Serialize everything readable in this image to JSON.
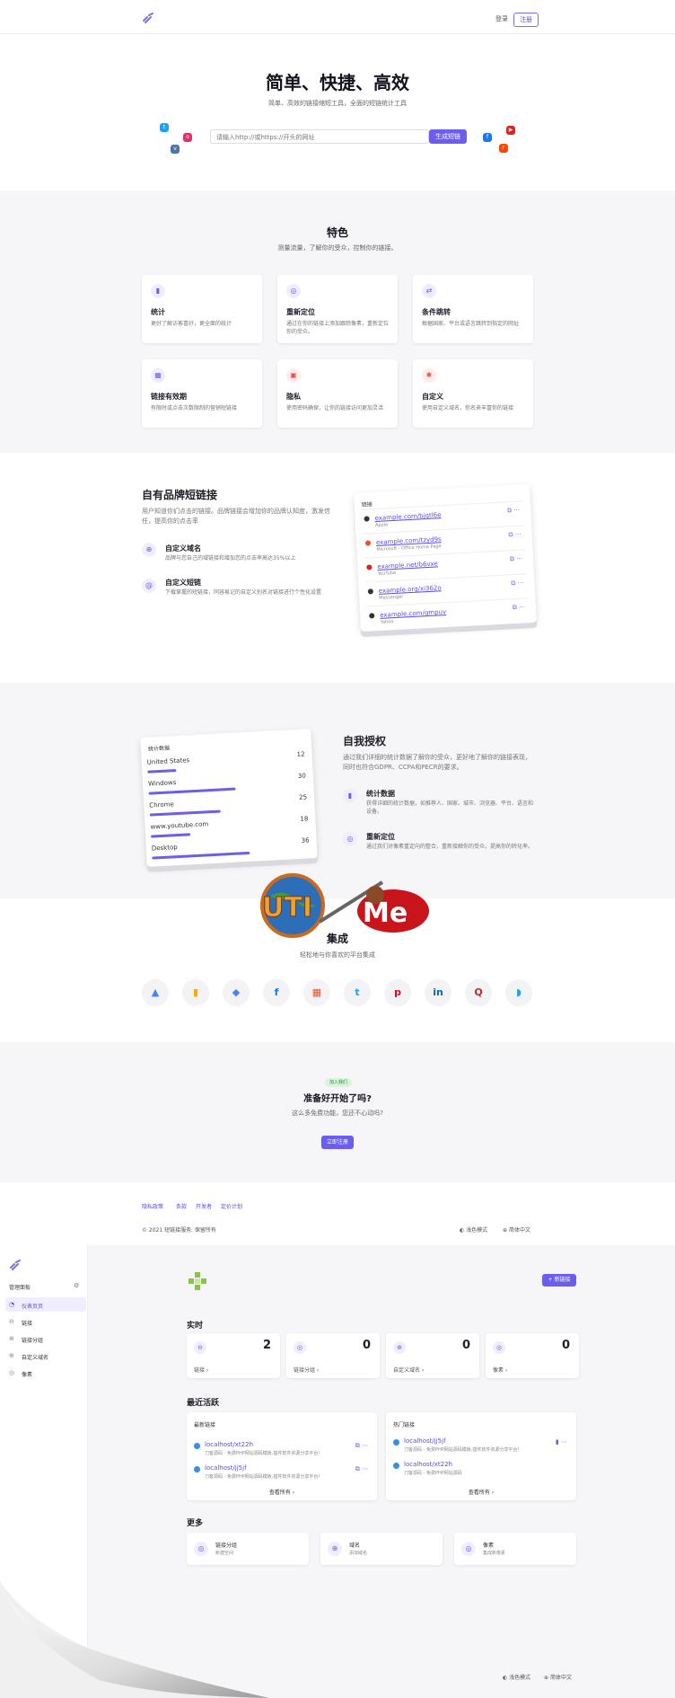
{
  "nav": {
    "login": "登录",
    "register": "注册"
  },
  "hero": {
    "title": "简单、快捷、高效",
    "subtitle": "简单、高效的链接缩短工具，全面的短链统计工具",
    "placeholder": "请输入http://或https://开头的网址",
    "button": "生成短链"
  },
  "features": {
    "title": "特色",
    "subtitle": "测量流量，了解你的受众，控制你的链接。",
    "items": [
      {
        "title": "统计",
        "desc": "更好了解访客喜好，更全面的统计",
        "icon": "chart-icon"
      },
      {
        "title": "重新定位",
        "desc": "通过在你的链接上添加跟踪像素，重新定位你的受众。",
        "icon": "target-icon"
      },
      {
        "title": "条件跳转",
        "desc": "根据国家、平台或语言跳转到指定的网址",
        "icon": "redirect-icon"
      },
      {
        "title": "链接有效期",
        "desc": "有限时或点击次数限制的营销短链接",
        "icon": "calendar-icon"
      },
      {
        "title": "隐私",
        "desc": "使用密码确保，让你的链接访问更加灵活",
        "icon": "lock-icon"
      },
      {
        "title": "自定义",
        "desc": "使用自定义域名，你名来丰富你的链接",
        "icon": "gear-icon"
      }
    ]
  },
  "brand": {
    "title": "自有品牌短链接",
    "desc": "用户知道你们点击的链接。品牌链接会增加你的品牌认知度，激发信任，提高你的点击率",
    "items": [
      {
        "title": "自定义域名",
        "desc": "品牌与您自己的域链接和增加您的点击率高达35%以上"
      },
      {
        "title": "自定义短链",
        "desc": "下载掌握的短链接，同容易记的自定义别名对链接进行个性化设置"
      }
    ],
    "card_title": "链接",
    "links": [
      {
        "url": "example.com/bjgtl6e",
        "sub": "Apple",
        "color": "#333333"
      },
      {
        "url": "example.com/tzyd9s",
        "sub": "Microsoft - Office Home Page",
        "color": "#f25022"
      },
      {
        "url": "example.net/b6vxe",
        "sub": "YouTube",
        "color": "#e62117"
      },
      {
        "url": "example.org/xi362o",
        "sub": "Messenger",
        "color": "#333333"
      },
      {
        "url": "example.com/gmpuv",
        "sub": "Yahoo",
        "color": "#333333"
      }
    ]
  },
  "empower": {
    "title": "自我授权",
    "desc": "通过我们详细的统计数据了解你的受众，更好地了解你的链接表现，同时也符合GDPR、CCPA和PECR的要求。",
    "items": [
      {
        "title": "统计数据",
        "desc": "获得详细的统计数据，如推荐人、国家、城市、浏览器、平台、语言和设备。"
      },
      {
        "title": "重新定位",
        "desc": "通过我们对像素重定向的整合，重新接触你的受众，提高你的转化率。"
      }
    ],
    "card_title": "统计数据",
    "stats": [
      {
        "name": "United States",
        "value": 12,
        "pct": 0.18
      },
      {
        "name": "Windows",
        "value": 30,
        "pct": 0.55
      },
      {
        "name": "Chrome",
        "value": 25,
        "pct": 0.45
      },
      {
        "name": "www.youtube.com",
        "value": 18,
        "pct": 0.25
      },
      {
        "name": "Desktop",
        "value": 36,
        "pct": 0.62
      }
    ]
  },
  "logo_watermark": "UTiMe",
  "integrations": {
    "title": "集成",
    "subtitle": "轻松地与你喜欢的平台集成",
    "icons": [
      "google-ads-icon",
      "analytics-icon",
      "tag-manager-icon",
      "facebook-icon",
      "microsoft-icon",
      "twitter-icon",
      "pinterest-icon",
      "linkedin-icon",
      "quora-icon",
      "bluesky-icon"
    ]
  },
  "cta": {
    "badge": "加入我们",
    "title": "准备好开始了吗?",
    "subtitle": "这么多免费功能，您还不心动吗?",
    "button": "立即注册"
  },
  "footer": {
    "links": [
      "隐私政策",
      "条款",
      "开发者",
      "定价计划"
    ],
    "copyright": "© 2021 短链接服务. 保留所有",
    "theme": "浅色模式",
    "language": "简体中文"
  },
  "dashboard": {
    "sidebar_title": "管理面板",
    "sidebar": [
      "仪表页页",
      "链接",
      "链接分组",
      "自定义域名",
      "像素"
    ],
    "new_link": "新链接",
    "realtime_title": "实时",
    "stats": [
      {
        "label": "链接",
        "value": "2"
      },
      {
        "label": "链接分组",
        "value": "0"
      },
      {
        "label": "自定义域名",
        "value": "0"
      },
      {
        "label": "像素",
        "value": "0"
      }
    ],
    "activity_title": "最近活跃",
    "latest_title": "最新链接",
    "popular_title": "热门链接",
    "latest": [
      {
        "url": "localhost/xt22h",
        "desc": "刀客源码 - 免费PHP网站源码模板,插件软件资源分享平台!"
      },
      {
        "url": "localhost/jj5jf",
        "desc": "刀客源码 - 免费PHP网站源码模板,插件软件资源分享平台!"
      }
    ],
    "popular": [
      {
        "url": "localhost/jj5jf",
        "desc": "刀客源码 - 免费PHP网站源码模板,插件软件资源分享平台!"
      },
      {
        "url": "localhost/xt22h",
        "desc": "刀客源码 - 免费PHP网站源码"
      }
    ],
    "view_all": "查看所有",
    "more_title": "更多",
    "more": [
      {
        "title": "链接分组",
        "sub": "新建空间"
      },
      {
        "title": "域名",
        "sub": "添加域名"
      },
      {
        "title": "像素",
        "sub": "集成新像素"
      }
    ],
    "theme": "浅色模式",
    "language": "简体中文"
  }
}
